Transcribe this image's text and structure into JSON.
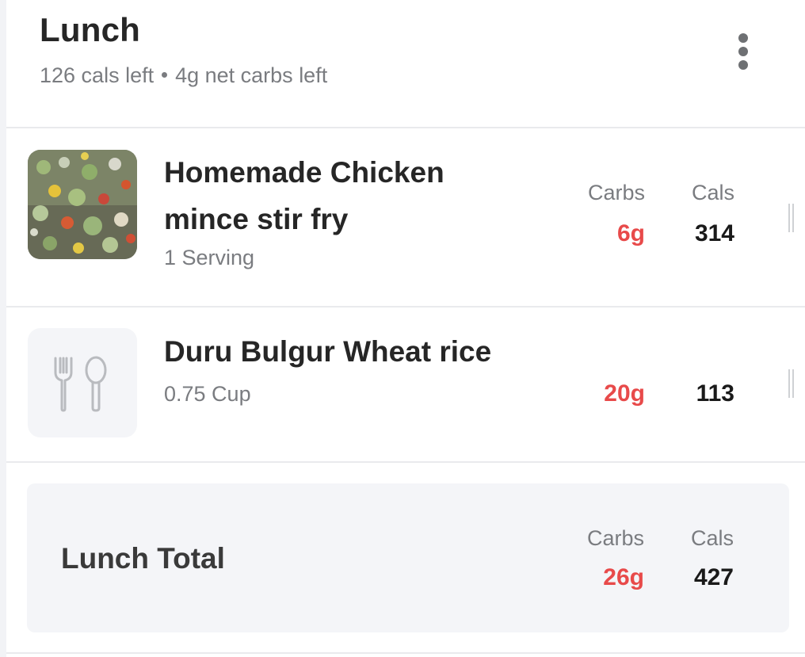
{
  "meal": {
    "title": "Lunch",
    "cals_left": "126 cals left",
    "carbs_left": "4g net carbs left",
    "more_icon": "more-vertical-icon"
  },
  "columns": {
    "carbs": "Carbs",
    "cals": "Cals"
  },
  "foods": [
    {
      "name": "Homemade Chicken mince stir fry",
      "serving": "1 Serving",
      "carbs": "6g",
      "cals": "314",
      "image": "food-photo"
    },
    {
      "name": "Duru Bulgur Wheat rice",
      "serving": "0.75 Cup",
      "carbs": "20g",
      "cals": "113",
      "image": "fork-spoon-icon"
    }
  ],
  "total": {
    "label": "Lunch Total",
    "carbs": "26g",
    "cals": "427"
  },
  "colors": {
    "carbs_accent": "#e84a4a",
    "muted_text": "#7a7c80",
    "total_bg": "#f4f5f8"
  }
}
